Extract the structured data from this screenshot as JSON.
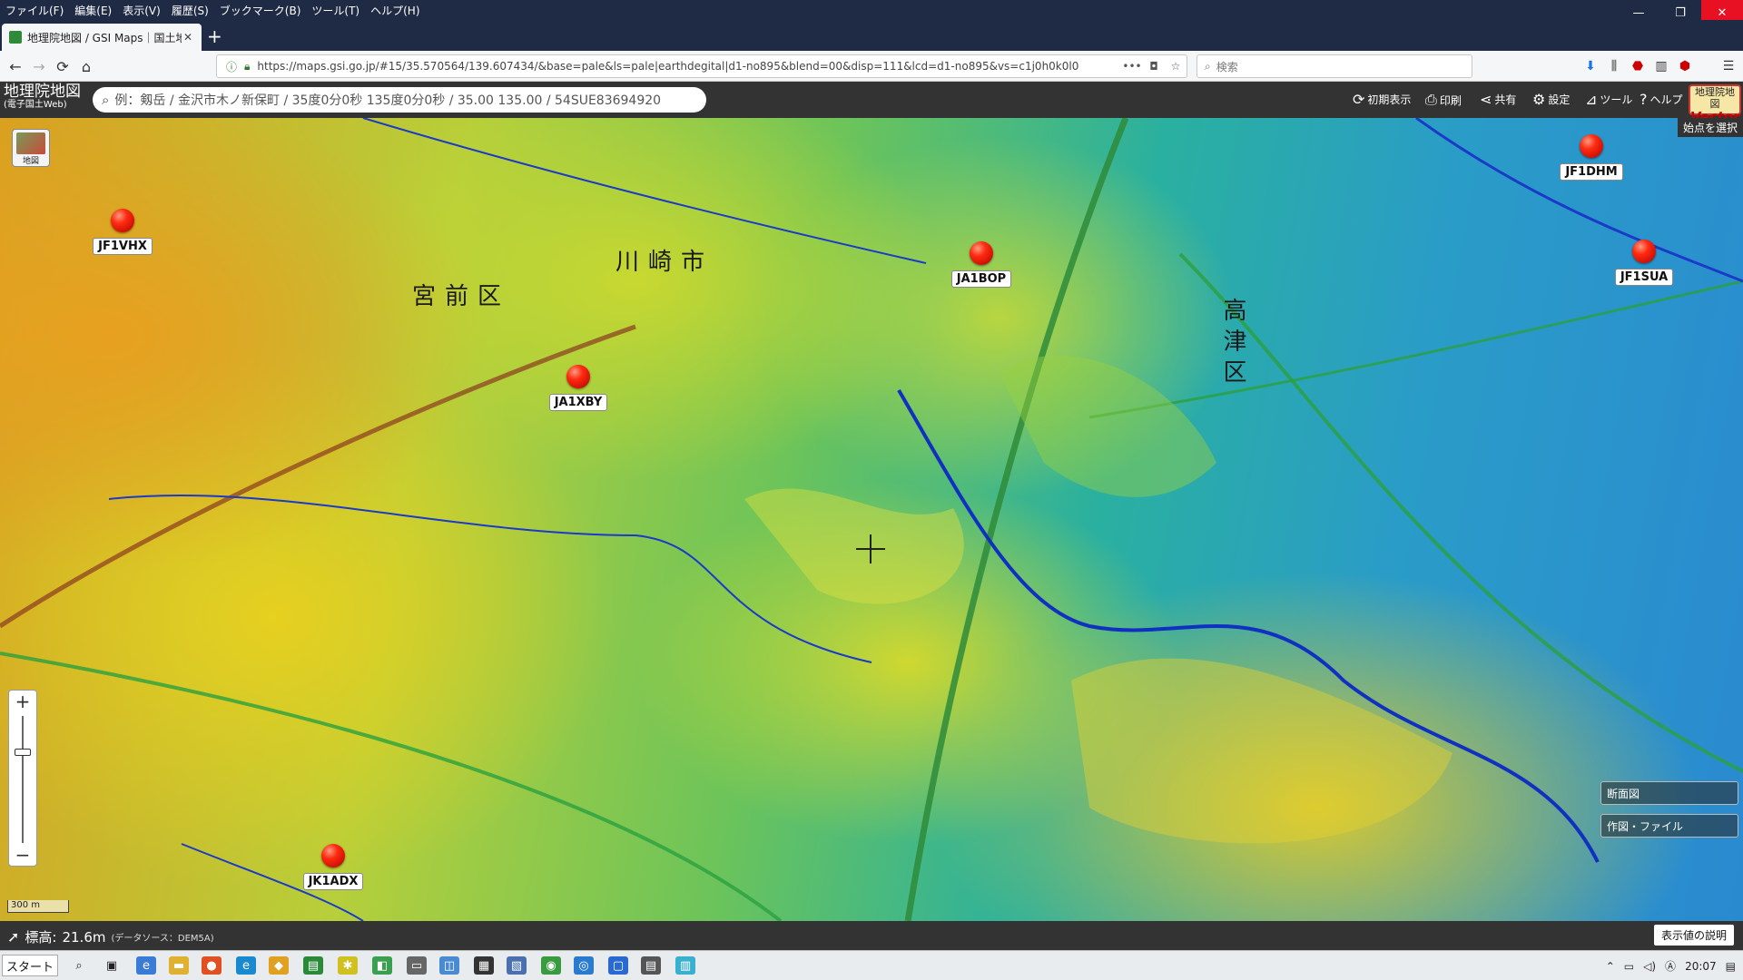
{
  "browser": {
    "menu": [
      "ファイル(F)",
      "編集(E)",
      "表示(V)",
      "履歴(S)",
      "ブックマーク(B)",
      "ツール(T)",
      "ヘルプ(H)"
    ],
    "tab_title": "地理院地図 / GSI Maps｜国土地",
    "url": "https://maps.gsi.go.jp/#15/35.570564/139.607434/&base=pale&ls=pale|earthdegital|d1-no895&blend=00&disp=111&lcd=d1-no895&vs=c1j0h0k0l0",
    "search_placeholder": "検索",
    "window_controls": {
      "minimize": "—",
      "restore": "❐",
      "close": "✕"
    }
  },
  "gsi": {
    "logo_main": "地理院地図",
    "logo_sub": "(電子国土Web)",
    "search_placeholder": "例：剱岳 / 金沢市木ノ新保町 / 35度0分0秒 135度0分0秒 / 35.00 135.00 / 54SUE83694920",
    "buttons": {
      "reset": "初期表示",
      "print": "印刷",
      "share": "共有",
      "settings": "設定",
      "tools": "ツール",
      "help": "ヘルプ"
    },
    "vector_logo": {
      "line1": "地理院地図",
      "line2": "Vector"
    }
  },
  "map": {
    "toggle_label": "地図",
    "start_point_hint": "始点を選択",
    "place_labels": {
      "city": "川崎市",
      "ward_miyamae": "宮前区",
      "ward_takatsu": "高津区"
    },
    "markers": [
      {
        "callsign": "JF1VHX"
      },
      {
        "callsign": "JA1BOP"
      },
      {
        "callsign": "JF1DHM"
      },
      {
        "callsign": "JF1SUA"
      },
      {
        "callsign": "JA1XBY"
      },
      {
        "callsign": "JK1ADX"
      }
    ],
    "scale": "300 m",
    "zoom_in": "+",
    "zoom_out": "−",
    "panels": {
      "profile": "断面図",
      "draw_file": "作図・ファイル"
    }
  },
  "status": {
    "elevation_label": "標高:",
    "elevation_value": "21.6m",
    "data_source": "(データソース：DEM5A)",
    "legend_button": "表示値の説明"
  },
  "taskbar": {
    "start_label": "スタート",
    "clock": "20:07"
  }
}
